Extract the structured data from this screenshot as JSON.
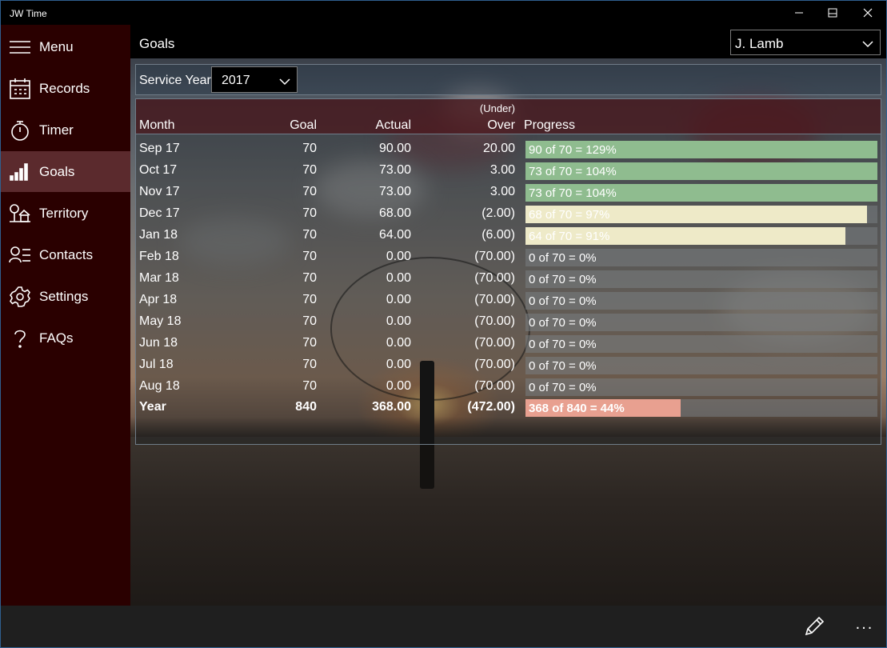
{
  "window": {
    "title": "JW Time",
    "minimize_icon": "minimize-icon",
    "maximize_icon": "maximize-icon",
    "close_icon": "close-icon"
  },
  "sidebar": {
    "items": [
      {
        "label": "Menu",
        "icon": "hamburger-icon",
        "active": false
      },
      {
        "label": "Records",
        "icon": "calendar-icon",
        "active": false
      },
      {
        "label": "Timer",
        "icon": "stopwatch-icon",
        "active": false
      },
      {
        "label": "Goals",
        "icon": "signal-bars-icon",
        "active": true
      },
      {
        "label": "Territory",
        "icon": "territory-icon",
        "active": false
      },
      {
        "label": "Contacts",
        "icon": "contacts-icon",
        "active": false
      },
      {
        "label": "Settings",
        "icon": "gear-icon",
        "active": false
      },
      {
        "label": "FAQs",
        "icon": "question-icon",
        "active": false
      }
    ]
  },
  "header": {
    "title": "Goals",
    "user_select": {
      "value": "J. Lamb",
      "icon": "chevron-down-icon"
    }
  },
  "service_year": {
    "label": "Service Year",
    "value": "2017"
  },
  "table": {
    "columns": {
      "month": "Month",
      "goal": "Goal",
      "actual": "Actual",
      "over_top": "(Under)",
      "over": "Over",
      "progress": "Progress"
    },
    "rows": [
      {
        "month": "Sep 17",
        "goal": "70",
        "actual": "90.00",
        "over": "20.00",
        "progress": "90 of 70 = 129%",
        "fill": 1.0,
        "color": "#8fbc8f"
      },
      {
        "month": "Oct 17",
        "goal": "70",
        "actual": "73.00",
        "over": "3.00",
        "progress": "73 of 70 = 104%",
        "fill": 1.0,
        "color": "#8fbc8f"
      },
      {
        "month": "Nov 17",
        "goal": "70",
        "actual": "73.00",
        "over": "3.00",
        "progress": "73 of 70 = 104%",
        "fill": 1.0,
        "color": "#8fbc8f"
      },
      {
        "month": "Dec 17",
        "goal": "70",
        "actual": "68.00",
        "over": "(2.00)",
        "progress": "68 of 70 = 97%",
        "fill": 0.97,
        "color": "#eeeac8"
      },
      {
        "month": "Jan 18",
        "goal": "70",
        "actual": "64.00",
        "over": "(6.00)",
        "progress": "64 of 70 = 91%",
        "fill": 0.91,
        "color": "#eeeac8"
      },
      {
        "month": "Feb 18",
        "goal": "70",
        "actual": "0.00",
        "over": "(70.00)",
        "progress": "0 of 70 = 0%",
        "fill": 0,
        "color": "#eeeac8"
      },
      {
        "month": "Mar 18",
        "goal": "70",
        "actual": "0.00",
        "over": "(70.00)",
        "progress": "0 of 70 = 0%",
        "fill": 0,
        "color": "#eeeac8"
      },
      {
        "month": "Apr 18",
        "goal": "70",
        "actual": "0.00",
        "over": "(70.00)",
        "progress": "0 of 70 = 0%",
        "fill": 0,
        "color": "#eeeac8"
      },
      {
        "month": "May 18",
        "goal": "70",
        "actual": "0.00",
        "over": "(70.00)",
        "progress": "0 of 70 = 0%",
        "fill": 0,
        "color": "#eeeac8"
      },
      {
        "month": "Jun 18",
        "goal": "70",
        "actual": "0.00",
        "over": "(70.00)",
        "progress": "0 of 70 = 0%",
        "fill": 0,
        "color": "#eeeac8"
      },
      {
        "month": "Jul 18",
        "goal": "70",
        "actual": "0.00",
        "over": "(70.00)",
        "progress": "0 of 70 = 0%",
        "fill": 0,
        "color": "#eeeac8"
      },
      {
        "month": "Aug 18",
        "goal": "70",
        "actual": "0.00",
        "over": "(70.00)",
        "progress": "0 of 70 = 0%",
        "fill": 0,
        "color": "#eeeac8"
      }
    ],
    "total": {
      "month": "Year",
      "goal": "840",
      "actual": "368.00",
      "over": "(472.00)",
      "progress": "368 of 840 = 44%",
      "fill": 0.44,
      "color": "#e8a090"
    }
  },
  "appbar": {
    "edit_icon": "pencil-icon",
    "more_label": "..."
  }
}
